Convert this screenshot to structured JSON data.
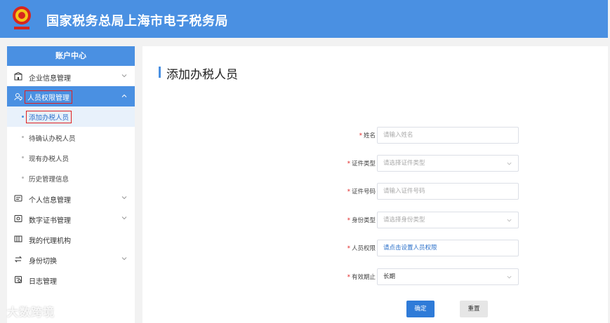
{
  "header": {
    "title": "国家税务总局上海市电子税务局",
    "logo_icon": "tax-emblem-icon"
  },
  "sidebar": {
    "title": "账户中心",
    "items": [
      {
        "label": "企业信息管理",
        "icon": "building-icon",
        "has_chevron": true
      },
      {
        "label": "人员权限管理",
        "icon": "user-shield-icon",
        "has_chevron": true,
        "active": true
      },
      {
        "label": "个人信息管理",
        "icon": "id-card-icon",
        "has_chevron": true
      },
      {
        "label": "数字证书管理",
        "icon": "certificate-icon",
        "has_chevron": true
      },
      {
        "label": "我的代理机构",
        "icon": "agency-icon",
        "has_chevron": false
      },
      {
        "label": "身份切换",
        "icon": "switch-icon",
        "has_chevron": true
      },
      {
        "label": "日志管理",
        "icon": "log-icon",
        "has_chevron": false
      }
    ],
    "sub_items": [
      {
        "label": "添加办税人员",
        "current": true
      },
      {
        "label": "待确认办税人员"
      },
      {
        "label": "现有办税人员"
      },
      {
        "label": "历史管理信息"
      }
    ]
  },
  "main": {
    "title": "添加办税人员",
    "form": [
      {
        "label": "姓名",
        "placeholder": "请输入姓名",
        "value": "",
        "type": "input"
      },
      {
        "label": "证件类型",
        "placeholder": "请选择证件类型",
        "value": "",
        "type": "select"
      },
      {
        "label": "证件号码",
        "placeholder": "请输入证件号码",
        "value": "",
        "type": "input"
      },
      {
        "label": "身份类型",
        "placeholder": "请选择身份类型",
        "value": "",
        "type": "select"
      },
      {
        "label": "人员权限",
        "placeholder": "",
        "value": "请点击设置人员权限",
        "type": "link"
      },
      {
        "label": "有效期止",
        "placeholder": "",
        "value": "长期",
        "type": "select"
      }
    ],
    "buttons": {
      "confirm": "确定",
      "reset": "重置"
    }
  },
  "watermark": "大数跨境",
  "colors": {
    "accent": "#4a90e2",
    "highlight_border": "#e02020",
    "button_primary": "#2f7bd8"
  }
}
